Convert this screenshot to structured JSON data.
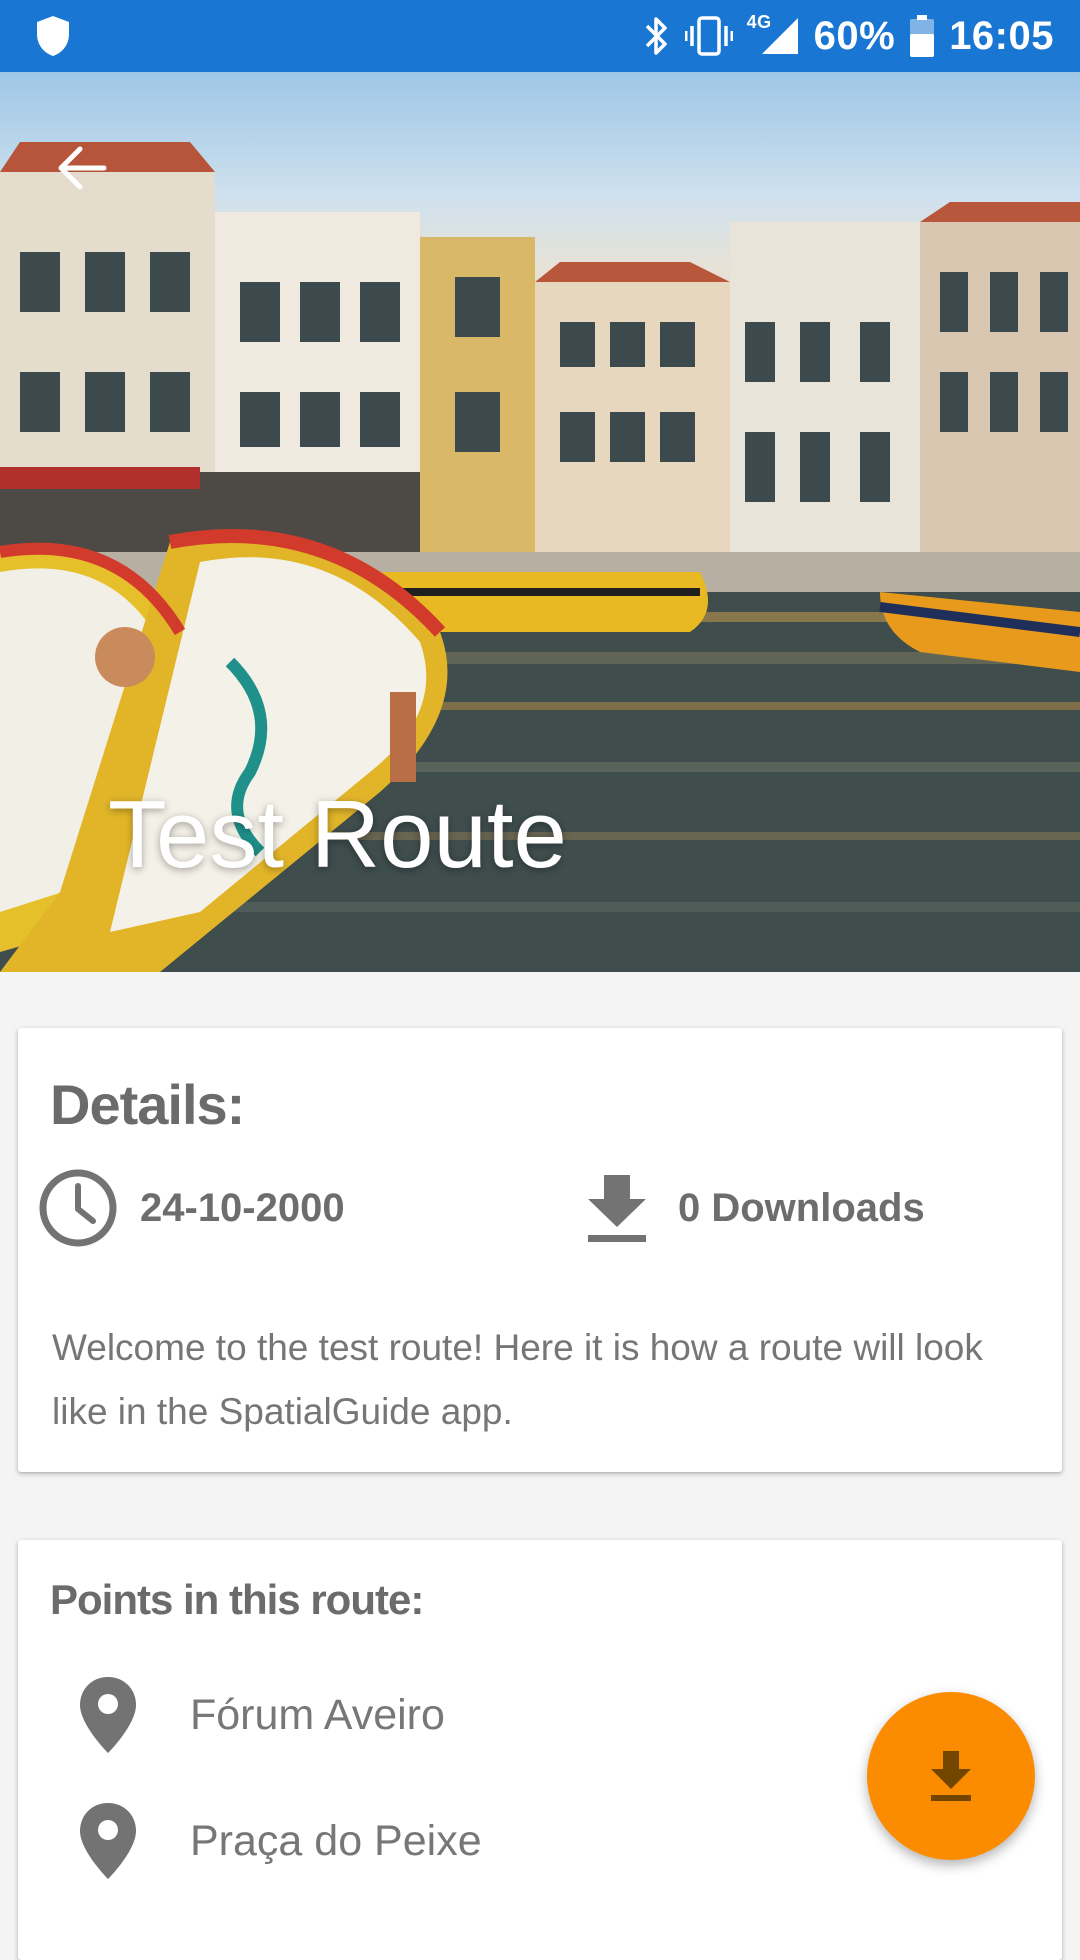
{
  "status_bar": {
    "battery_percent": "60%",
    "time": "16:05",
    "network_type": "4G",
    "icons": [
      "shield-icon",
      "bluetooth-icon",
      "vibrate-icon",
      "signal-icon",
      "battery-icon"
    ]
  },
  "hero": {
    "title": "Test Route",
    "back_icon": "arrow-back-icon",
    "image_description": "canal with colorful moliceiro boats and historic buildings"
  },
  "details": {
    "heading": "Details:",
    "date": "24-10-2000",
    "downloads": "0 Downloads",
    "description": "Welcome to the test route! Here it is how a route will look like in the SpatialGuide app."
  },
  "points": {
    "heading": "Points in this route:",
    "items": [
      {
        "label": "Fórum Aveiro",
        "icon": "map-pin-icon"
      },
      {
        "label": "Praça do Peixe",
        "icon": "map-pin-icon"
      }
    ]
  },
  "fab": {
    "icon": "download-icon"
  },
  "colors": {
    "status_bar": "#1976d2",
    "fab": "#fb8c00",
    "heading_text": "#6b6b6b",
    "body_text": "#767676"
  }
}
